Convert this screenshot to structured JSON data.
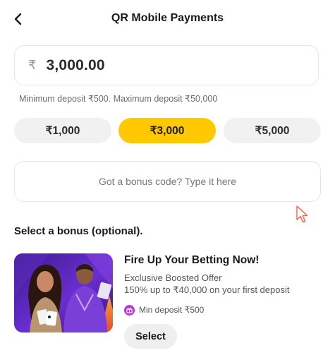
{
  "header": {
    "title": "QR Mobile Payments",
    "back_icon": "chevron-left-icon"
  },
  "amount": {
    "currency_symbol": "₹",
    "value": "3,000.00"
  },
  "limits_text": "Minimum deposit ₹500. Maximum deposit ₹50,000",
  "quick_amounts": [
    {
      "label": "₹1,000",
      "selected": false
    },
    {
      "label": "₹3,000",
      "selected": true
    },
    {
      "label": "₹5,000",
      "selected": false
    }
  ],
  "bonus_code": {
    "placeholder": "Got a bonus code? Type it here"
  },
  "bonus_section": {
    "heading": "Select a bonus (optional).",
    "offers": [
      {
        "title": "Fire Up Your Betting Now!",
        "subtitle": "Exclusive Boosted Offer",
        "description": "150% up to ₹40,000 on your first deposit",
        "min_deposit": "Min deposit ₹500",
        "select_label": "Select",
        "badge_icon": "gift-icon"
      }
    ]
  },
  "colors": {
    "accent": "#ffc800",
    "chip_bg": "#f1f1f1",
    "badge": "#b23ad6",
    "cursor": "#ff6b4a"
  }
}
